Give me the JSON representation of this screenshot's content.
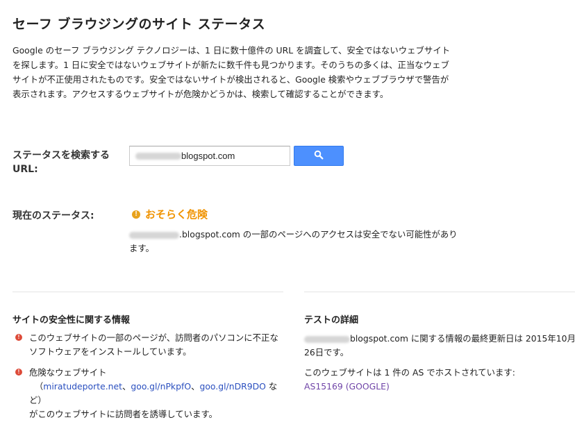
{
  "page": {
    "title": "セーフ ブラウジングのサイト ステータス",
    "intro": "Google のセーフ ブラウジング テクノロジーは、1 日に数十億件の URL を調査して、安全ではないウェブサイトを探します。1 日に安全ではないウェブサイトが新たに数千件も見つかります。そのうちの多くは、正当なウェブサイトが不正使用されたものです。安全ではないサイトが検出されると、Google 検索やウェブブラウザで警告が表示されます。アクセスするウェブサイトが危険かどうかは、検索して確認することができます。"
  },
  "search": {
    "label": "ステータスを検索する URL:",
    "value_visible": "blogspot.com",
    "button_icon": "search-icon"
  },
  "status": {
    "label": "現在のステータス:",
    "value": "おそらく危険",
    "icon": "warning-icon",
    "description_domain": ".blogspot.com",
    "description": " の一部のページへのアクセスは安全でない可能性があります。"
  },
  "site_info": {
    "heading": "サイトの安全性に関する情報",
    "issue1": "このウェブサイトの一部のページが、訪問者のパソコンに不正なソフトウェアをインストールしています。",
    "issue2_prefix": "危険なウェブサイト",
    "issue2_open": "（",
    "issue2_links": [
      "miratudeporte.net",
      "goo.gl/nPkpfO",
      "goo.gl/nDR9DO"
    ],
    "issue2_sep": "、",
    "issue2_close": " など）",
    "issue2_suffix": "がこのウェブサイトに訪問者を誘導しています。"
  },
  "test_details": {
    "heading": "テストの詳細",
    "updated_domain": "blogspot.com",
    "updated_text": " に関する情報の最終更新日は 2015年10月26日です。",
    "hosted_text": "このウェブサイトは 1 件の AS でホストされています:",
    "as_link": "AS15169 (GOOGLE)"
  },
  "colors": {
    "button_blue": "#4d90fe",
    "warning_orange": "#f09300",
    "error_red": "#dd4b39",
    "link_blue": "#2a4fbf",
    "as_link_purple": "#7045a8"
  }
}
